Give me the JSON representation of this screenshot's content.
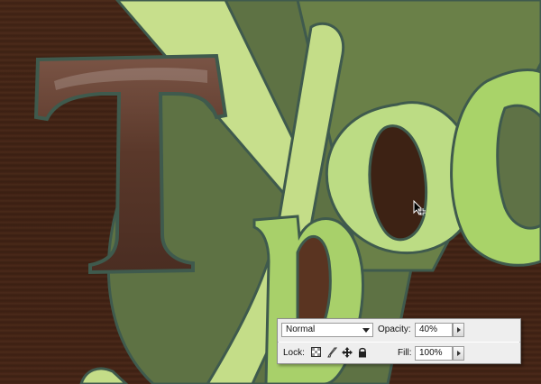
{
  "layers_panel": {
    "blend_mode": "Normal",
    "opacity_label": "Opacity:",
    "opacity_value": "40%",
    "lock_label": "Lock:",
    "fill_label": "Fill:",
    "fill_value": "100%",
    "lock_icons": [
      "lock-transparent-icon",
      "lock-paint-icon",
      "lock-move-icon",
      "lock-all-icon"
    ]
  },
  "artwork": {
    "letters": [
      "T",
      "y",
      "p",
      "o",
      "g"
    ],
    "colors": {
      "wood": "#4a2818",
      "dark_green": "#5d7040",
      "light_green": "#c7e08a",
      "mid_green": "#a9d36a",
      "brown_letter": "#5e3a2c",
      "outline": "#3f5a4d"
    }
  },
  "cursor": "move-cursor-icon"
}
